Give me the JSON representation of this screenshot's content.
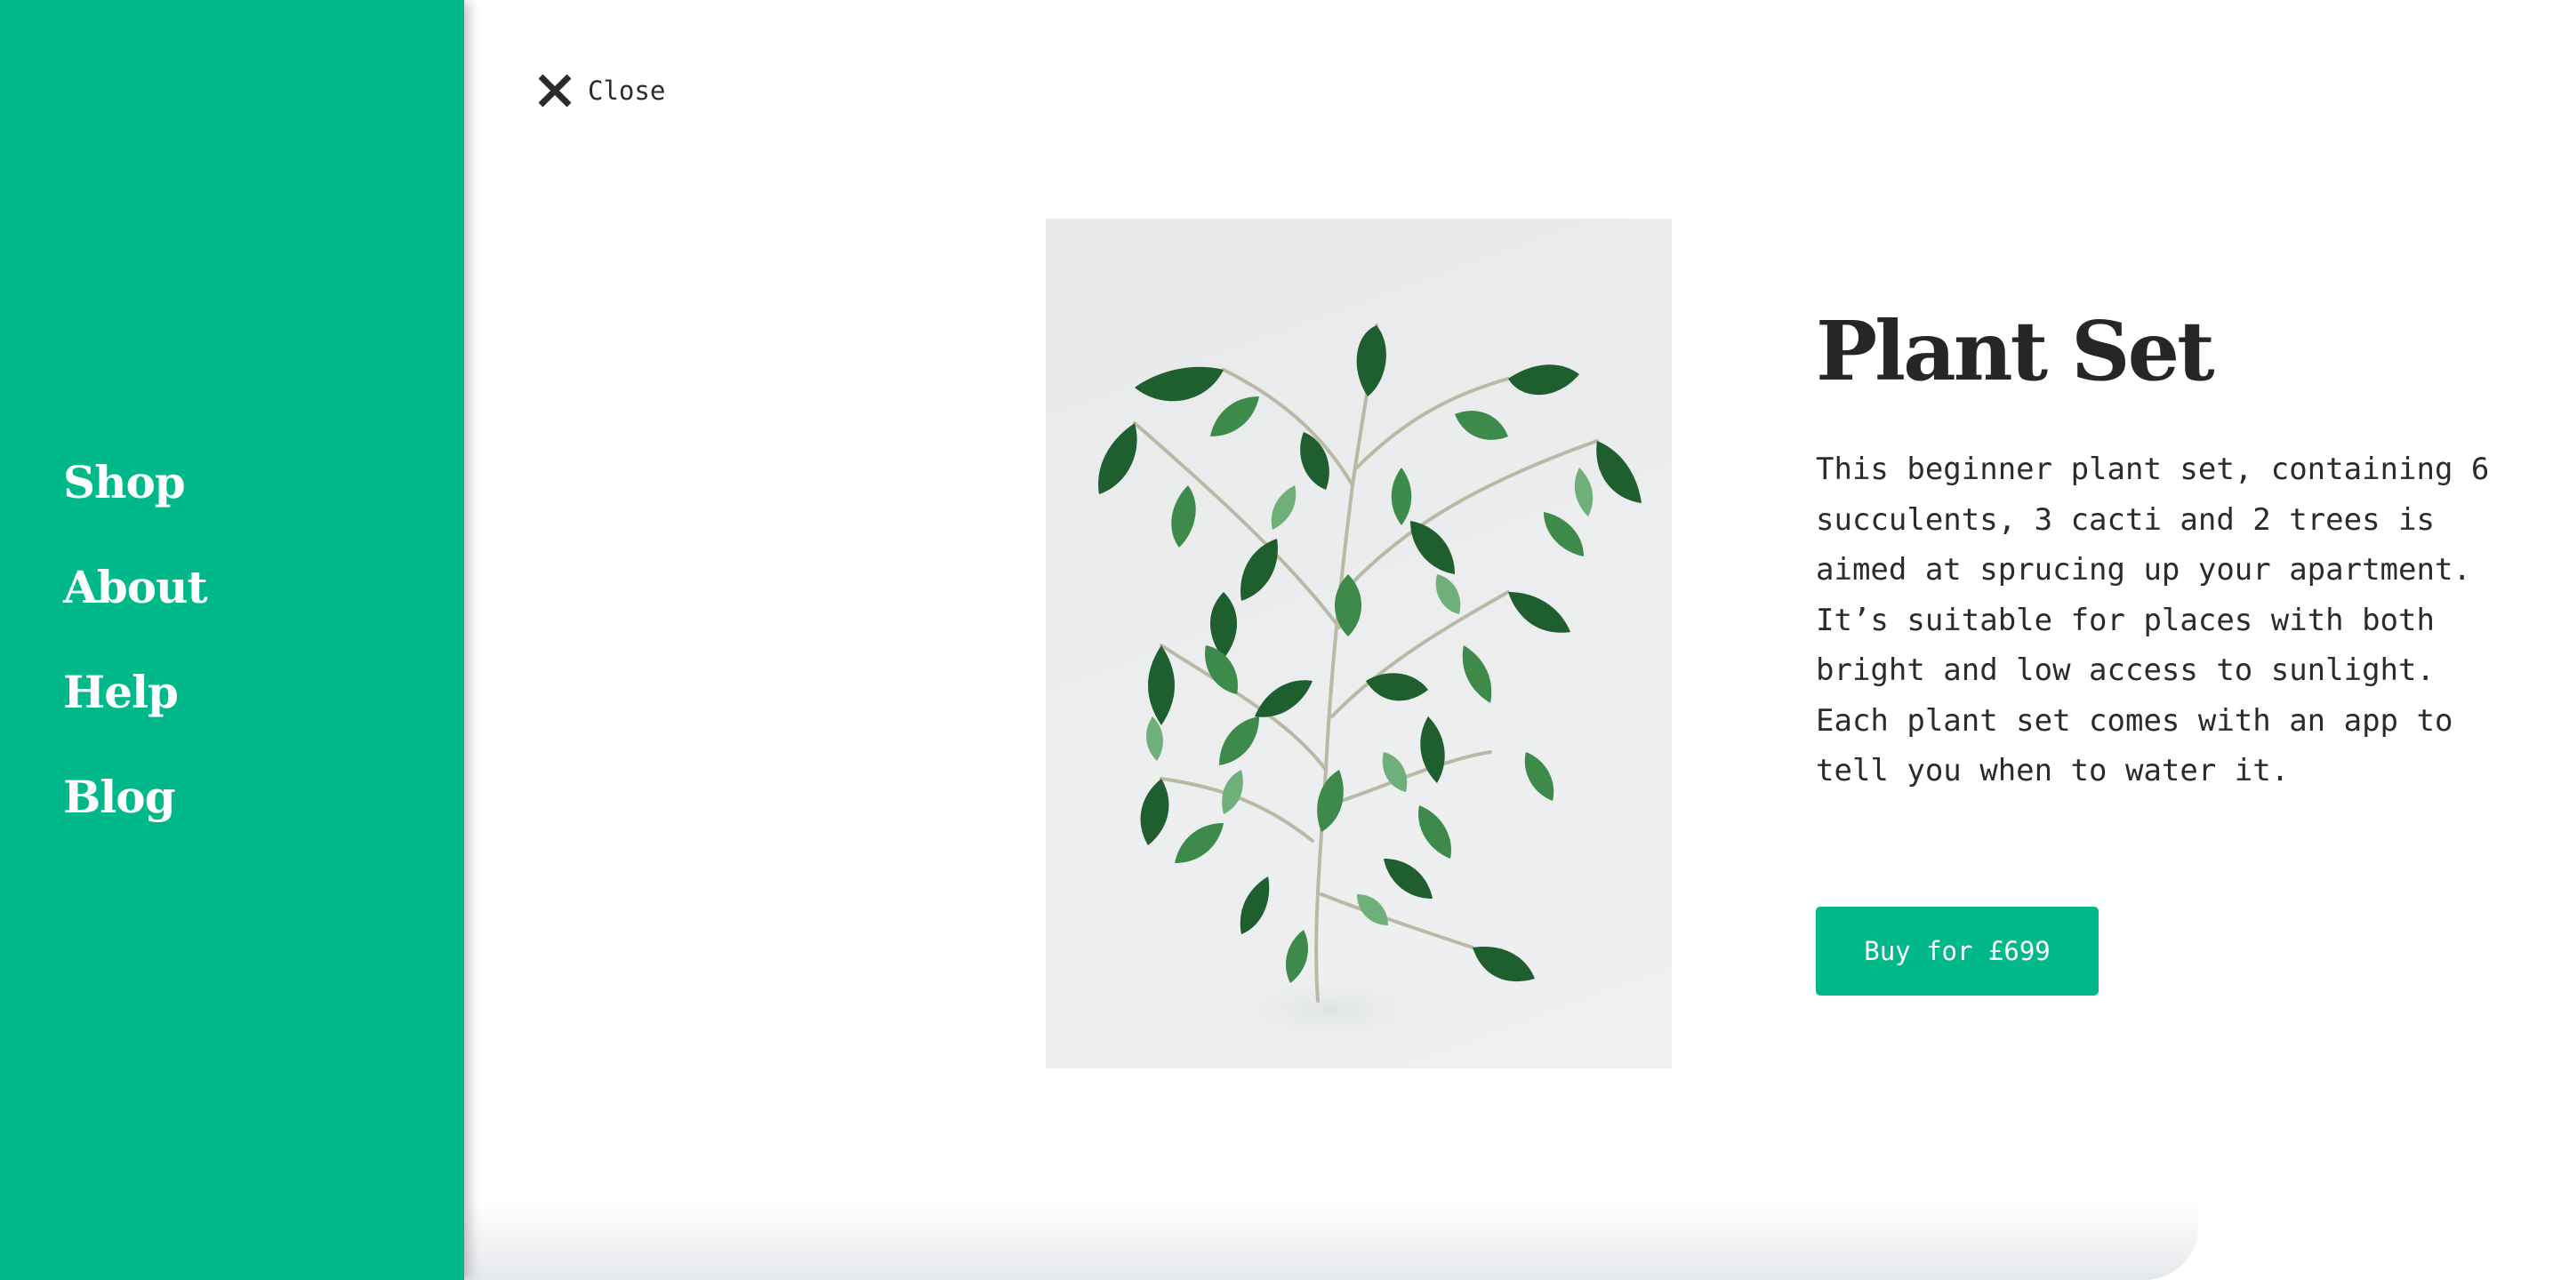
{
  "sidebar": {
    "background_color": "#00b88a",
    "items": [
      {
        "label": "Shop"
      },
      {
        "label": "About"
      },
      {
        "label": "Help"
      },
      {
        "label": "Blog"
      }
    ]
  },
  "close": {
    "label": "Close",
    "icon": "close-icon"
  },
  "product": {
    "title": "Plant Set",
    "description": "This beginner plant set, containing 6 succulents, 3 cacti and 2 trees is aimed at sprucing up your apartment. It’s suitable for places with both bright and low access to sunlight. Each plant set comes with an app to tell you when to water it.",
    "buy_label": "Buy for £699",
    "image": "plant-photo",
    "accent_color": "#00b88a"
  }
}
